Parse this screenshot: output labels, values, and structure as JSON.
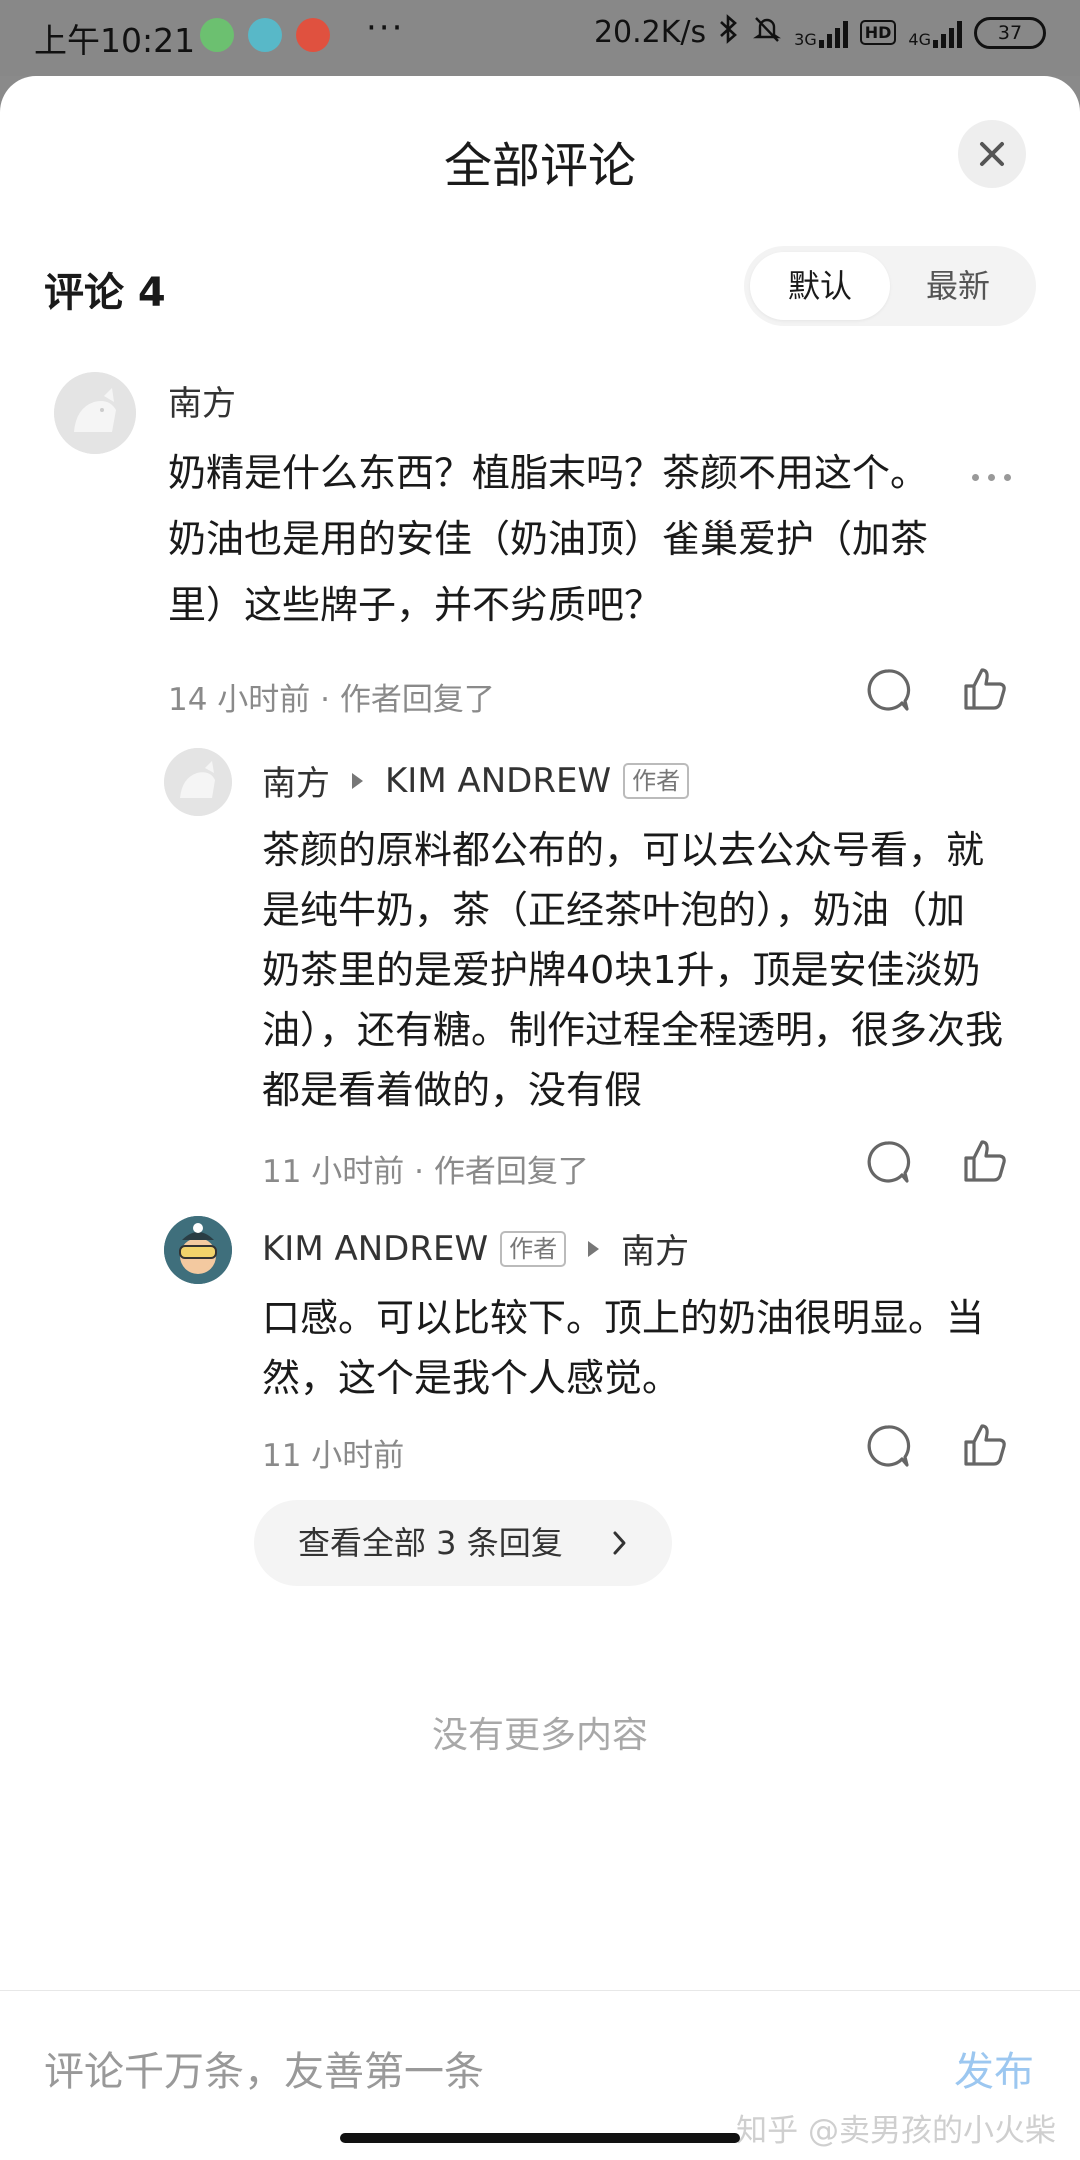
{
  "status_bar": {
    "time": "上午10:21",
    "dots": "···",
    "net_speed": "20.2K/s",
    "sig1_label": "3G",
    "sig2_label": "4G",
    "hd_label": "HD",
    "battery": "37"
  },
  "sheet": {
    "title": "全部评论",
    "comment_count_label": "评论 4",
    "sort_options": [
      "默认",
      "最新"
    ]
  },
  "comments": [
    {
      "author": "南方",
      "text_lines": [
        "奶精是什么东西？植脂末吗？茶颜不用这个。",
        "奶油也是用的安佳（奶油顶）雀巢爱护（加茶",
        "里）这些牌子，并不劣质吧？"
      ],
      "meta": "14 小时前 · 作者回复了"
    }
  ],
  "replies": [
    {
      "author": "南方",
      "reply_to": "KIM ANDREW",
      "reply_to_tag": "作者",
      "text_lines": [
        "茶颜的原料都公布的，可以去公众号看，就",
        "是纯牛奶，茶（正经茶叶泡的），奶油（加",
        "奶茶里的是爱护牌40块1升，顶是安佳淡奶",
        "油），还有糖。制作过程全程透明，很多次我",
        "都是看着做的，没有假"
      ],
      "meta": "11 小时前 · 作者回复了"
    },
    {
      "author": "KIM ANDREW",
      "author_tag": "作者",
      "reply_to": "南方",
      "text_lines": [
        "口感。可以比较下。顶上的奶油很明显。当",
        "然，这个是我个人感觉。"
      ],
      "meta": "11 小时前"
    }
  ],
  "view_all_replies": "查看全部 3 条回复",
  "no_more": "没有更多内容",
  "bottom_bar": {
    "placeholder": "评论千万条，友善第一条",
    "publish": "发布"
  },
  "watermark": "知乎 @卖男孩的小火柴",
  "colors": {
    "publish": "#9cc7f0",
    "meta_gray": "#8a8a8a"
  }
}
